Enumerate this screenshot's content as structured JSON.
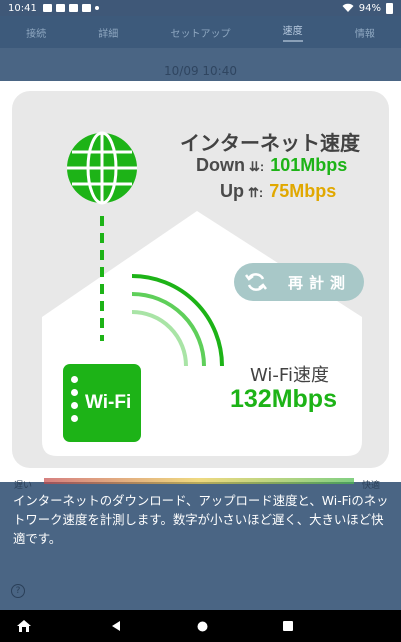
{
  "status_bar": {
    "time": "10:41",
    "battery_percent": "94%",
    "icons": [
      "image-icon",
      "cast-icon",
      "mail-icon",
      "a-icon",
      "dot-icon",
      "wifi-icon",
      "battery-icon"
    ]
  },
  "app_header": {
    "tabs": [
      "接続",
      "詳細",
      "セットアップ",
      "速度",
      "情報"
    ],
    "active_tab": "速度",
    "date": "10/09 10:40"
  },
  "dialog": {
    "internet": {
      "title": "インターネット速度",
      "down_label": "Down",
      "down_arrows": "⇊:",
      "down_value": "101Mbps",
      "up_label": "Up",
      "up_arrows": "⇈:",
      "up_value": "75Mbps"
    },
    "remeasure_label": "再計測",
    "device_label": "Wi-Fi",
    "wifi": {
      "title": "Wi-Fi速度",
      "value": "132Mbps"
    }
  },
  "scale": {
    "slow": "遅い",
    "fast": "快適"
  },
  "description": "インターネットのダウンロード、アップロード速度と、Wi-Fiのネットワーク速度を計測します。数字が小さいほど遅く、大きいほど快適です。",
  "help_symbol": "?",
  "colors": {
    "accent_green": "#1DB317",
    "up_gold": "#E1A800",
    "button_teal": "#A8C8C8",
    "background_blue": "#3F5878"
  }
}
